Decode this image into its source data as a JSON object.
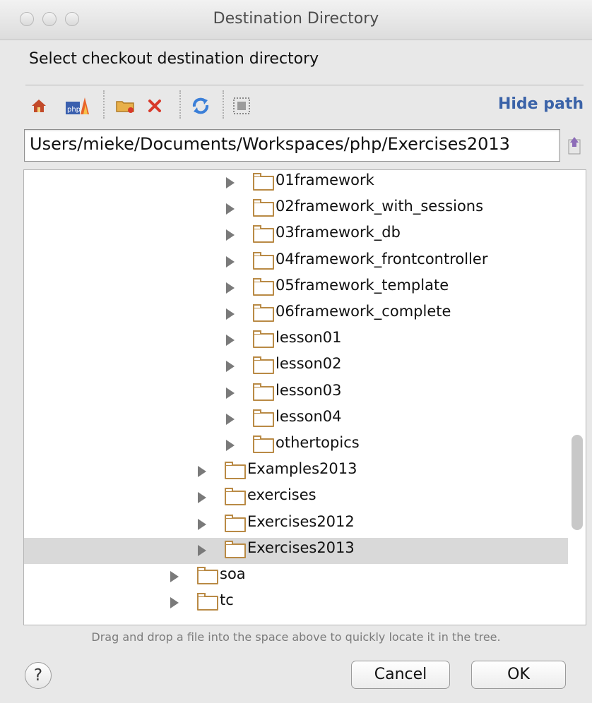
{
  "window": {
    "title": "Destination Directory"
  },
  "dialog": {
    "header": "Select checkout destination directory"
  },
  "toolbar": {
    "icons": [
      "home-icon",
      "php-project-icon",
      "new-folder-icon",
      "delete-icon",
      "refresh-icon",
      "show-hidden-icon"
    ],
    "hide_path_label": "Hide path"
  },
  "path_field": {
    "value": "Users/mieke/Documents/Workspaces/php/Exercises2013"
  },
  "tree": {
    "items": [
      {
        "label": "01framework",
        "depth": 3,
        "selected": false
      },
      {
        "label": "02framework_with_sessions",
        "depth": 3,
        "selected": false
      },
      {
        "label": "03framework_db",
        "depth": 3,
        "selected": false
      },
      {
        "label": "04framework_frontcontroller",
        "depth": 3,
        "selected": false
      },
      {
        "label": "05framework_template",
        "depth": 3,
        "selected": false
      },
      {
        "label": "06framework_complete",
        "depth": 3,
        "selected": false
      },
      {
        "label": "lesson01",
        "depth": 3,
        "selected": false
      },
      {
        "label": "lesson02",
        "depth": 3,
        "selected": false
      },
      {
        "label": "lesson03",
        "depth": 3,
        "selected": false
      },
      {
        "label": "lesson04",
        "depth": 3,
        "selected": false
      },
      {
        "label": "othertopics",
        "depth": 3,
        "selected": false
      },
      {
        "label": "Examples2013",
        "depth": 2,
        "selected": false
      },
      {
        "label": "exercises",
        "depth": 2,
        "selected": false
      },
      {
        "label": "Exercises2012",
        "depth": 2,
        "selected": false
      },
      {
        "label": "Exercises2013",
        "depth": 2,
        "selected": true
      },
      {
        "label": "soa",
        "depth": 1,
        "selected": false
      },
      {
        "label": "tc",
        "depth": 1,
        "selected": false
      }
    ]
  },
  "hint": "Drag and drop a file into the space above to quickly locate it in the tree.",
  "buttons": {
    "help": "?",
    "cancel": "Cancel",
    "ok": "OK"
  },
  "colors": {
    "accent": "#3b63a8",
    "folder": "#b98a45",
    "selection": "#d9d9d9"
  }
}
